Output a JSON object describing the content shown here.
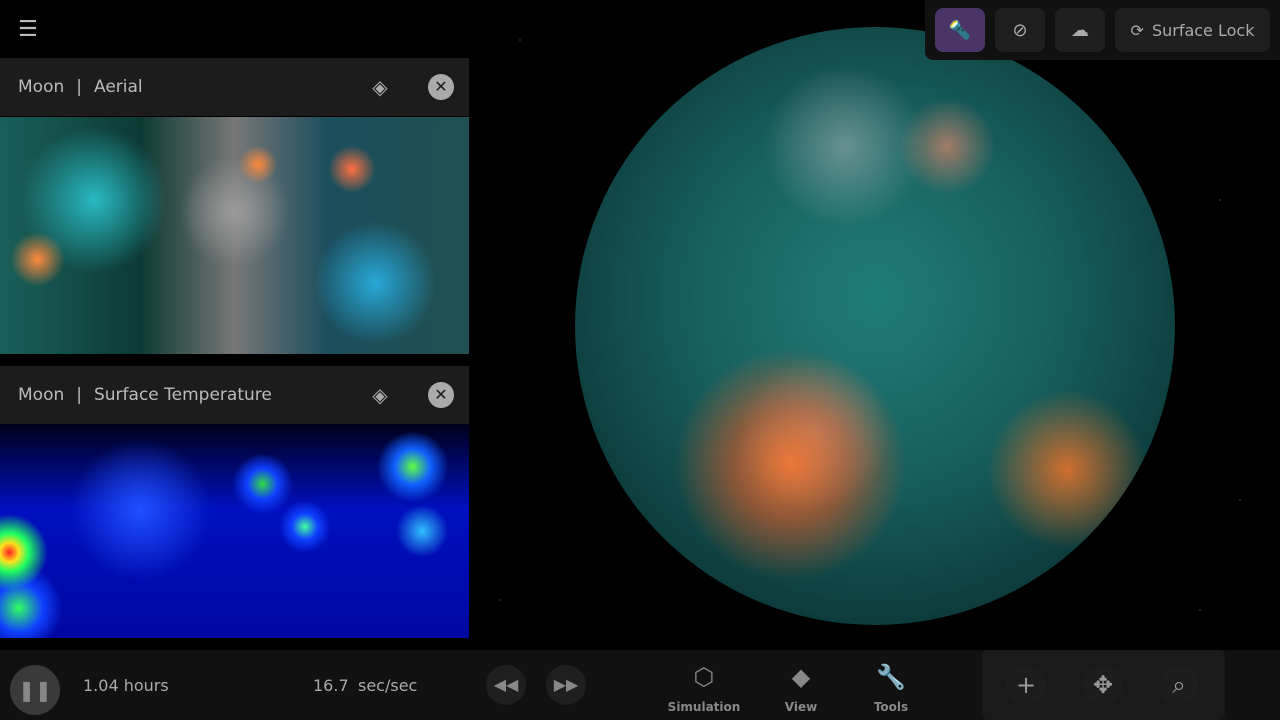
{
  "menu": {
    "icon": "hamburger-menu-icon"
  },
  "panels": [
    {
      "body": "Moon",
      "separator": "|",
      "layer": "Aerial",
      "layers_icon": "layers-icon",
      "close_icon": "close-icon"
    },
    {
      "body": "Moon",
      "separator": "|",
      "layer": "Surface Temperature",
      "layers_icon": "layers-icon",
      "close_icon": "close-icon"
    }
  ],
  "toolbar": {
    "buttons": [
      {
        "icon": "flashlight-icon",
        "active": true
      },
      {
        "icon": "sun-off-icon",
        "active": false
      },
      {
        "icon": "cloud-off-icon",
        "active": false
      },
      {
        "icon": "surface-lock-icon",
        "label": "Surface Lock",
        "active": false
      }
    ],
    "active_color": "#4a3566"
  },
  "playback": {
    "elapsed": "1.04 hours",
    "rate_value": "16.7",
    "rate_unit": "sec/sec"
  },
  "nav": [
    {
      "label": "Simulation",
      "icon": "cube-icon"
    },
    {
      "label": "View",
      "icon": "layers-icon"
    },
    {
      "label": "Tools",
      "icon": "wrench-icon"
    }
  ],
  "camera": [
    {
      "icon": "plus-icon"
    },
    {
      "icon": "recenter-icon"
    },
    {
      "icon": "search-icon"
    }
  ]
}
